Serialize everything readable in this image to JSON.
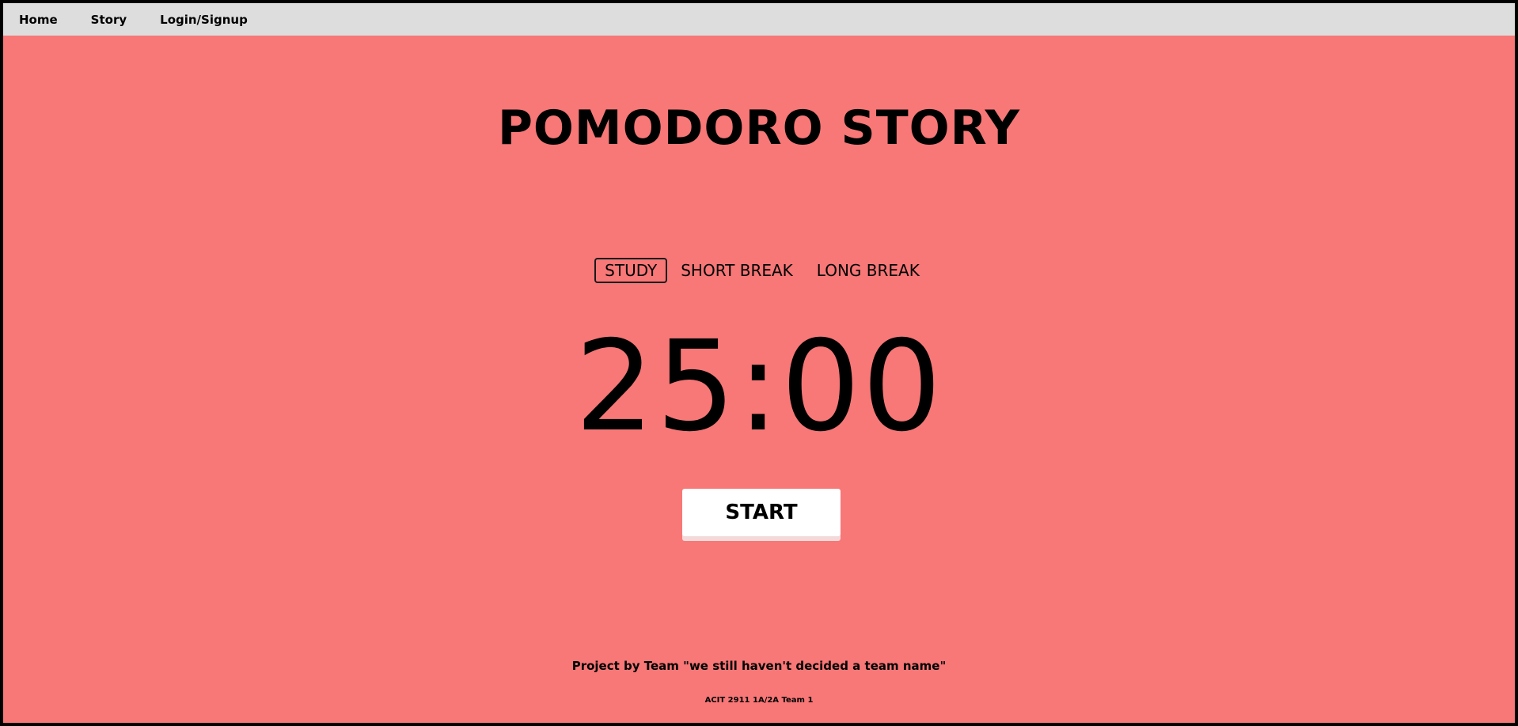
{
  "nav": {
    "items": [
      {
        "label": "Home"
      },
      {
        "label": "Story"
      },
      {
        "label": "Login/Signup"
      }
    ]
  },
  "header": {
    "title": "POMODORO STORY"
  },
  "modes": {
    "items": [
      {
        "label": "STUDY",
        "active": true
      },
      {
        "label": "SHORT BREAK",
        "active": false
      },
      {
        "label": "LONG BREAK",
        "active": false
      }
    ]
  },
  "timer": {
    "display": "25:00"
  },
  "controls": {
    "start_label": "START"
  },
  "footer": {
    "credit": "Project by Team \"we still haven't decided a team name\"",
    "course": "ACIT 2911 1A/2A Team 1"
  },
  "colors": {
    "background": "#f87777",
    "navbar": "#dddddd",
    "button": "#ffffff",
    "text": "#000000"
  }
}
